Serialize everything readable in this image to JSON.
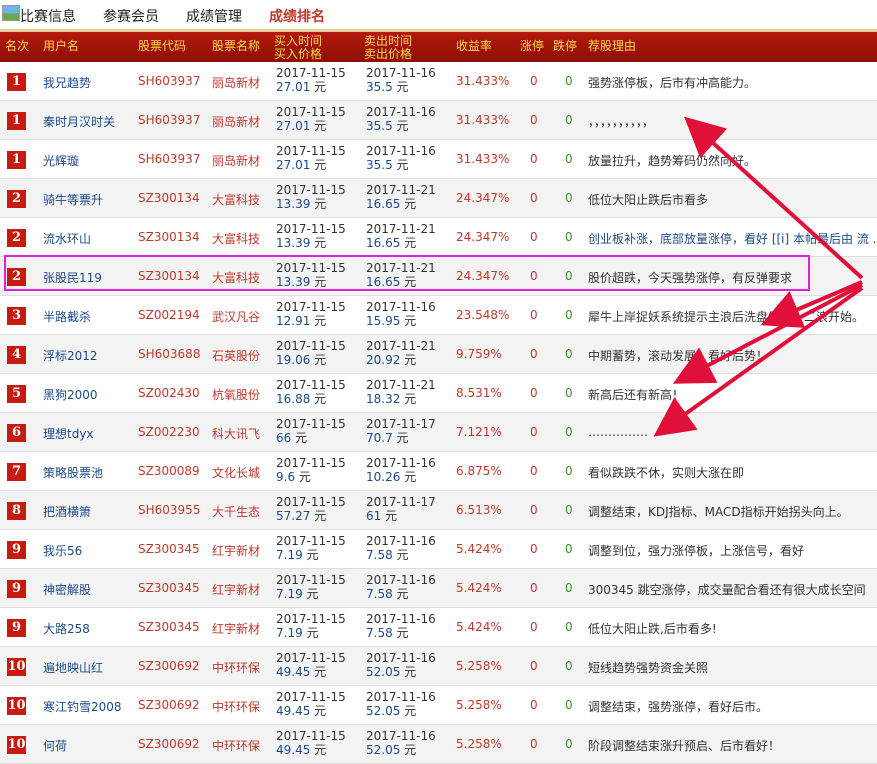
{
  "tabs": [
    {
      "label": "比赛信息",
      "active": false
    },
    {
      "label": "参赛会员",
      "active": false
    },
    {
      "label": "成绩管理",
      "active": false
    },
    {
      "label": "成绩排名",
      "active": true
    }
  ],
  "columns": {
    "rank": "名次",
    "user": "用户名",
    "code": "股票代码",
    "name": "股票名称",
    "buy_time": "买入时间",
    "buy_price": "买入价格",
    "sell_time": "卖出时间",
    "sell_price": "卖出价格",
    "yield": "收益率",
    "zt": "涨停",
    "dt": "跌停",
    "reason": "荐股理由"
  },
  "currency_unit": "元",
  "rows": [
    {
      "rank": "1",
      "user": "我兄趋势",
      "code": "SH603937",
      "name": "丽岛新材",
      "buy_time": "2017-11-15",
      "buy_price": "27.01",
      "sell_time": "2017-11-16",
      "sell_price": "35.5",
      "yield": "31.433%",
      "zt": "0",
      "dt": "0",
      "reason": "强势涨停板，后市有冲高能力。"
    },
    {
      "rank": "1",
      "user": "秦时月汉时关",
      "code": "SH603937",
      "name": "丽岛新材",
      "buy_time": "2017-11-15",
      "buy_price": "27.01",
      "sell_time": "2017-11-16",
      "sell_price": "35.5",
      "yield": "31.433%",
      "zt": "0",
      "dt": "0",
      "reason": "，，，，，，，，，，"
    },
    {
      "rank": "1",
      "user": "光辉璇",
      "code": "SH603937",
      "name": "丽岛新材",
      "buy_time": "2017-11-15",
      "buy_price": "27.01",
      "sell_time": "2017-11-16",
      "sell_price": "35.5",
      "yield": "31.433%",
      "zt": "0",
      "dt": "0",
      "reason": "放量拉升，趋势筹码仍然向好。"
    },
    {
      "rank": "2",
      "user": "骑牛等票升",
      "code": "SZ300134",
      "name": "大富科技",
      "buy_time": "2017-11-15",
      "buy_price": "13.39",
      "sell_time": "2017-11-21",
      "sell_price": "16.65",
      "yield": "24.347%",
      "zt": "0",
      "dt": "0",
      "reason": "低位大阳止跌后市看多"
    },
    {
      "rank": "2",
      "user": "流水环山",
      "code": "SZ300134",
      "name": "大富科技",
      "buy_time": "2017-11-15",
      "buy_price": "13.39",
      "sell_time": "2017-11-21",
      "sell_price": "16.65",
      "yield": "24.347%",
      "zt": "0",
      "dt": "0",
      "reason": "创业板补涨，底部放量涨停，看好 [[i] 本帖最后由 流 ..."
    },
    {
      "rank": "2",
      "user": "张股民119",
      "code": "SZ300134",
      "name": "大富科技",
      "buy_time": "2017-11-15",
      "buy_price": "13.39",
      "sell_time": "2017-11-21",
      "sell_price": "16.65",
      "yield": "24.347%",
      "zt": "0",
      "dt": "0",
      "reason": "股价超跌，今天强势涨停，有反弹要求"
    },
    {
      "rank": "3",
      "user": "半路截杀",
      "code": "SZ002194",
      "name": "武汉凡谷",
      "buy_time": "2017-11-15",
      "buy_price": "12.91",
      "sell_time": "2017-11-16",
      "sell_price": "15.95",
      "yield": "23.548%",
      "zt": "0",
      "dt": "0",
      "reason": "犀牛上岸捉妖系统提示主浪后洗盘结束，二浪开始。"
    },
    {
      "rank": "4",
      "user": "浮标2012",
      "code": "SH603688",
      "name": "石英股份",
      "buy_time": "2017-11-15",
      "buy_price": "19.06",
      "sell_time": "2017-11-21",
      "sell_price": "20.92",
      "yield": "9.759%",
      "zt": "0",
      "dt": "0",
      "reason": "中期蓄势，滚动发展，看好后势！"
    },
    {
      "rank": "5",
      "user": "黑狗2000",
      "code": "SZ002430",
      "name": "杭氧股份",
      "buy_time": "2017-11-15",
      "buy_price": "16.88",
      "sell_time": "2017-11-21",
      "sell_price": "18.32",
      "yield": "8.531%",
      "zt": "0",
      "dt": "0",
      "reason": "新高后还有新高！"
    },
    {
      "rank": "6",
      "user": "理想tdyx",
      "code": "SZ002230",
      "name": "科大讯飞",
      "buy_time": "2017-11-15",
      "buy_price": "66",
      "sell_time": "2017-11-17",
      "sell_price": "70.7",
      "yield": "7.121%",
      "zt": "0",
      "dt": "0",
      "reason": "……………"
    },
    {
      "rank": "7",
      "user": "策略股票池",
      "code": "SZ300089",
      "name": "文化长城",
      "buy_time": "2017-11-15",
      "buy_price": "9.6",
      "sell_time": "2017-11-16",
      "sell_price": "10.26",
      "yield": "6.875%",
      "zt": "0",
      "dt": "0",
      "reason": "看似跌跌不休，实则大涨在即"
    },
    {
      "rank": "8",
      "user": "把酒横箫",
      "code": "SH603955",
      "name": "大千生态",
      "buy_time": "2017-11-15",
      "buy_price": "57.27",
      "sell_time": "2017-11-17",
      "sell_price": "61",
      "yield": "6.513%",
      "zt": "0",
      "dt": "0",
      "reason": "调整结束，KDJ指标、MACD指标开始拐头向上。"
    },
    {
      "rank": "9",
      "user": "我乐56",
      "code": "SZ300345",
      "name": "红宇新材",
      "buy_time": "2017-11-15",
      "buy_price": "7.19",
      "sell_time": "2017-11-16",
      "sell_price": "7.58",
      "yield": "5.424%",
      "zt": "0",
      "dt": "0",
      "reason": "调整到位，强力涨停板，上涨信号，看好"
    },
    {
      "rank": "9",
      "user": "神密解股",
      "code": "SZ300345",
      "name": "红宇新材",
      "buy_time": "2017-11-15",
      "buy_price": "7.19",
      "sell_time": "2017-11-16",
      "sell_price": "7.58",
      "yield": "5.424%",
      "zt": "0",
      "dt": "0",
      "reason": "300345 跳空涨停，成交量配合看还有很大成长空间"
    },
    {
      "rank": "9",
      "user": "大路258",
      "code": "SZ300345",
      "name": "红宇新材",
      "buy_time": "2017-11-15",
      "buy_price": "7.19",
      "sell_time": "2017-11-16",
      "sell_price": "7.58",
      "yield": "5.424%",
      "zt": "0",
      "dt": "0",
      "reason": "低位大阳止跌,后市看多!"
    },
    {
      "rank": "10",
      "user": "遍地映山红",
      "code": "SZ300692",
      "name": "中环环保",
      "buy_time": "2017-11-15",
      "buy_price": "49.45",
      "sell_time": "2017-11-16",
      "sell_price": "52.05",
      "yield": "5.258%",
      "zt": "0",
      "dt": "0",
      "reason": "短线趋势强势资金关照"
    },
    {
      "rank": "10",
      "user": "寒江钓雪2008",
      "code": "SZ300692",
      "name": "中环环保",
      "buy_time": "2017-11-15",
      "buy_price": "49.45",
      "sell_time": "2017-11-16",
      "sell_price": "52.05",
      "yield": "5.258%",
      "zt": "0",
      "dt": "0",
      "reason": "调整结束，强势涨停，看好后市。"
    },
    {
      "rank": "10",
      "user": "何荷",
      "code": "SZ300692",
      "name": "中环环保",
      "buy_time": "2017-11-15",
      "buy_price": "49.45",
      "sell_time": "2017-11-16",
      "sell_price": "52.05",
      "yield": "5.258%",
      "zt": "0",
      "dt": "0",
      "reason": "阶段调整结束涨升预启、后市看好！"
    }
  ]
}
